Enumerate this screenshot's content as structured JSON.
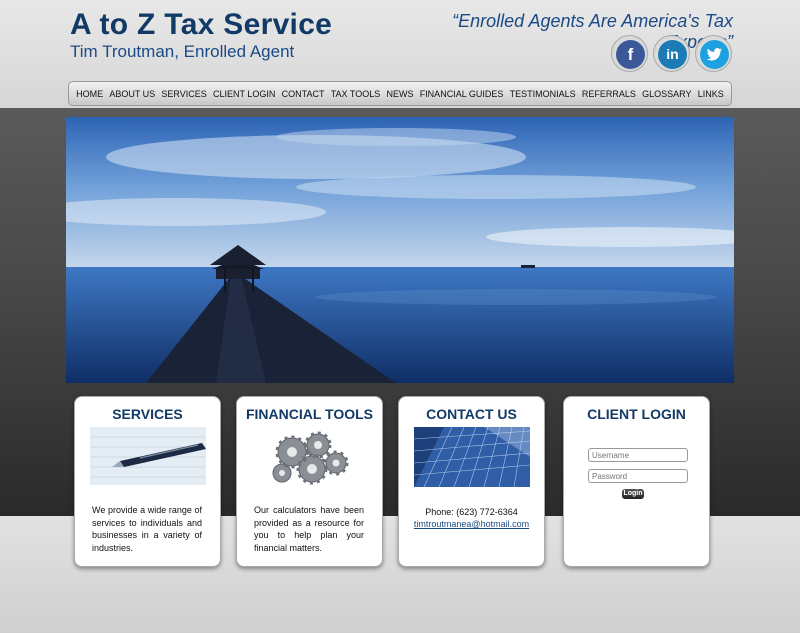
{
  "header": {
    "title": "A to Z Tax Service",
    "subtitle": "Tim Troutman, Enrolled Agent",
    "tagline": "“Enrolled Agents Are America's Tax Experts”"
  },
  "social": [
    {
      "icon": "facebook-icon",
      "glyph": "f",
      "color": "#3b5998"
    },
    {
      "icon": "linkedin-icon",
      "glyph": "in",
      "color": "#1c7bb5"
    },
    {
      "icon": "twitter-icon",
      "glyph": "t",
      "color": "#1ea1e0"
    }
  ],
  "nav": {
    "items": [
      "HOME",
      "ABOUT US",
      "SERVICES",
      "CLIENT LOGIN",
      "CONTACT",
      "TAX TOOLS",
      "NEWS",
      "FINANCIAL GUIDES",
      "TESTIMONIALS",
      "REFERRALS",
      "GLOSSARY",
      "LINKS"
    ]
  },
  "cards": {
    "services": {
      "title": "SERVICES",
      "text": "We provide a wide range of services to individuals and businesses in a variety of industries."
    },
    "financial_tools": {
      "title": "FINANCIAL TOOLS",
      "text": "Our calculators have been provided as a resource for you to help plan your financial matters."
    },
    "contact": {
      "title": "CONTACT US",
      "phone": "Phone: (623) 772-6364",
      "email": "timtroutmanea@hotmail.com"
    },
    "client_login": {
      "title": "CLIENT LOGIN",
      "username_placeholder": "Username",
      "password_placeholder": "Password",
      "login_label": "Login"
    }
  },
  "colors": {
    "brand": "#123a66",
    "accent": "#1b4a86"
  }
}
